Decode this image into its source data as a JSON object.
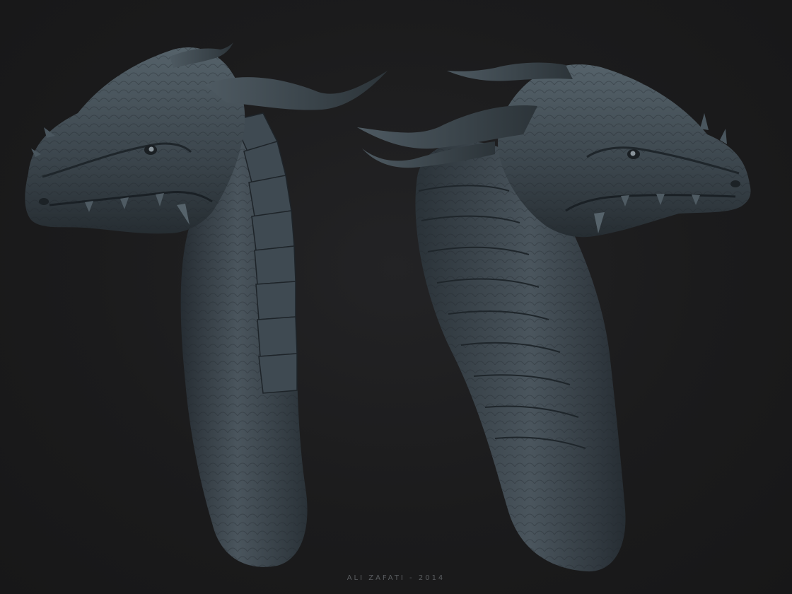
{
  "credit": "ALI ZAFATI - 2014",
  "colors": {
    "background": "#1b1b1c",
    "clay_base": "#3a434a",
    "clay_light": "#5b6870",
    "clay_dark": "#20262b"
  }
}
